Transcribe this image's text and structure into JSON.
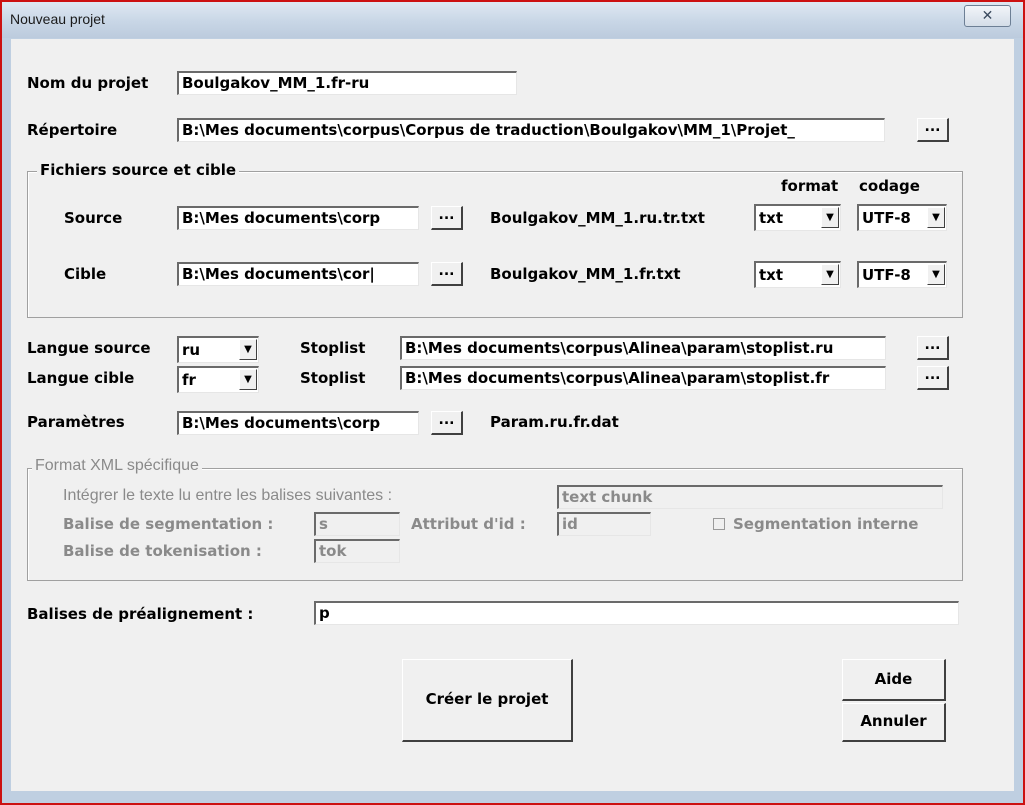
{
  "window": {
    "title": "Nouveau projet",
    "close_glyph": "✕"
  },
  "project": {
    "name_label": "Nom du projet",
    "name_value": "Boulgakov_MM_1.fr-ru"
  },
  "repertoire": {
    "label": "Répertoire",
    "value": "B:\\Mes documents\\corpus\\Corpus de traduction\\Boulgakov\\MM_1\\Projet_",
    "browse": "..."
  },
  "files": {
    "group_title": "Fichiers source et cible",
    "format_header": "format",
    "codage_header": "codage",
    "source": {
      "label": "Source",
      "path": "B:\\Mes documents\\corp",
      "browse": "...",
      "filename": "Boulgakov_MM_1.ru.tr.txt",
      "format": "txt",
      "codage": "UTF-8"
    },
    "cible": {
      "label": "Cible",
      "path": "B:\\Mes documents\\cor|",
      "browse": "...",
      "filename": "Boulgakov_MM_1.fr.txt",
      "format": "txt",
      "codage": "UTF-8"
    }
  },
  "langues": {
    "source_label": "Langue source",
    "source_value": "ru",
    "cible_label": "Langue cible",
    "cible_value": "fr",
    "stoplist_label": "Stoplist",
    "stoplist_source": "B:\\Mes documents\\corpus\\Alinea\\param\\stoplist.ru",
    "stoplist_cible": "B:\\Mes documents\\corpus\\Alinea\\param\\stoplist.fr",
    "browse": "..."
  },
  "parametres": {
    "label": "Paramètres",
    "path": "B:\\Mes documents\\corp",
    "browse": "...",
    "filename": "Param.ru.fr.dat"
  },
  "xml": {
    "group_title": "Format XML spécifique",
    "integrer_label": "Intégrer le texte lu entre les balises suivantes :",
    "integrer_value": "text chunk",
    "segmentation_label": "Balise de segmentation :",
    "segmentation_value": "s",
    "attribut_label": "Attribut d'id :",
    "attribut_value": "id",
    "segmentation_interne_label": "Segmentation interne",
    "tokenisation_label": "Balise de tokenisation :",
    "tokenisation_value": "tok"
  },
  "prealignement": {
    "label": "Balises de préalignement :",
    "value": "p"
  },
  "buttons": {
    "create": "Créer le projet",
    "help": "Aide",
    "cancel": "Annuler"
  }
}
